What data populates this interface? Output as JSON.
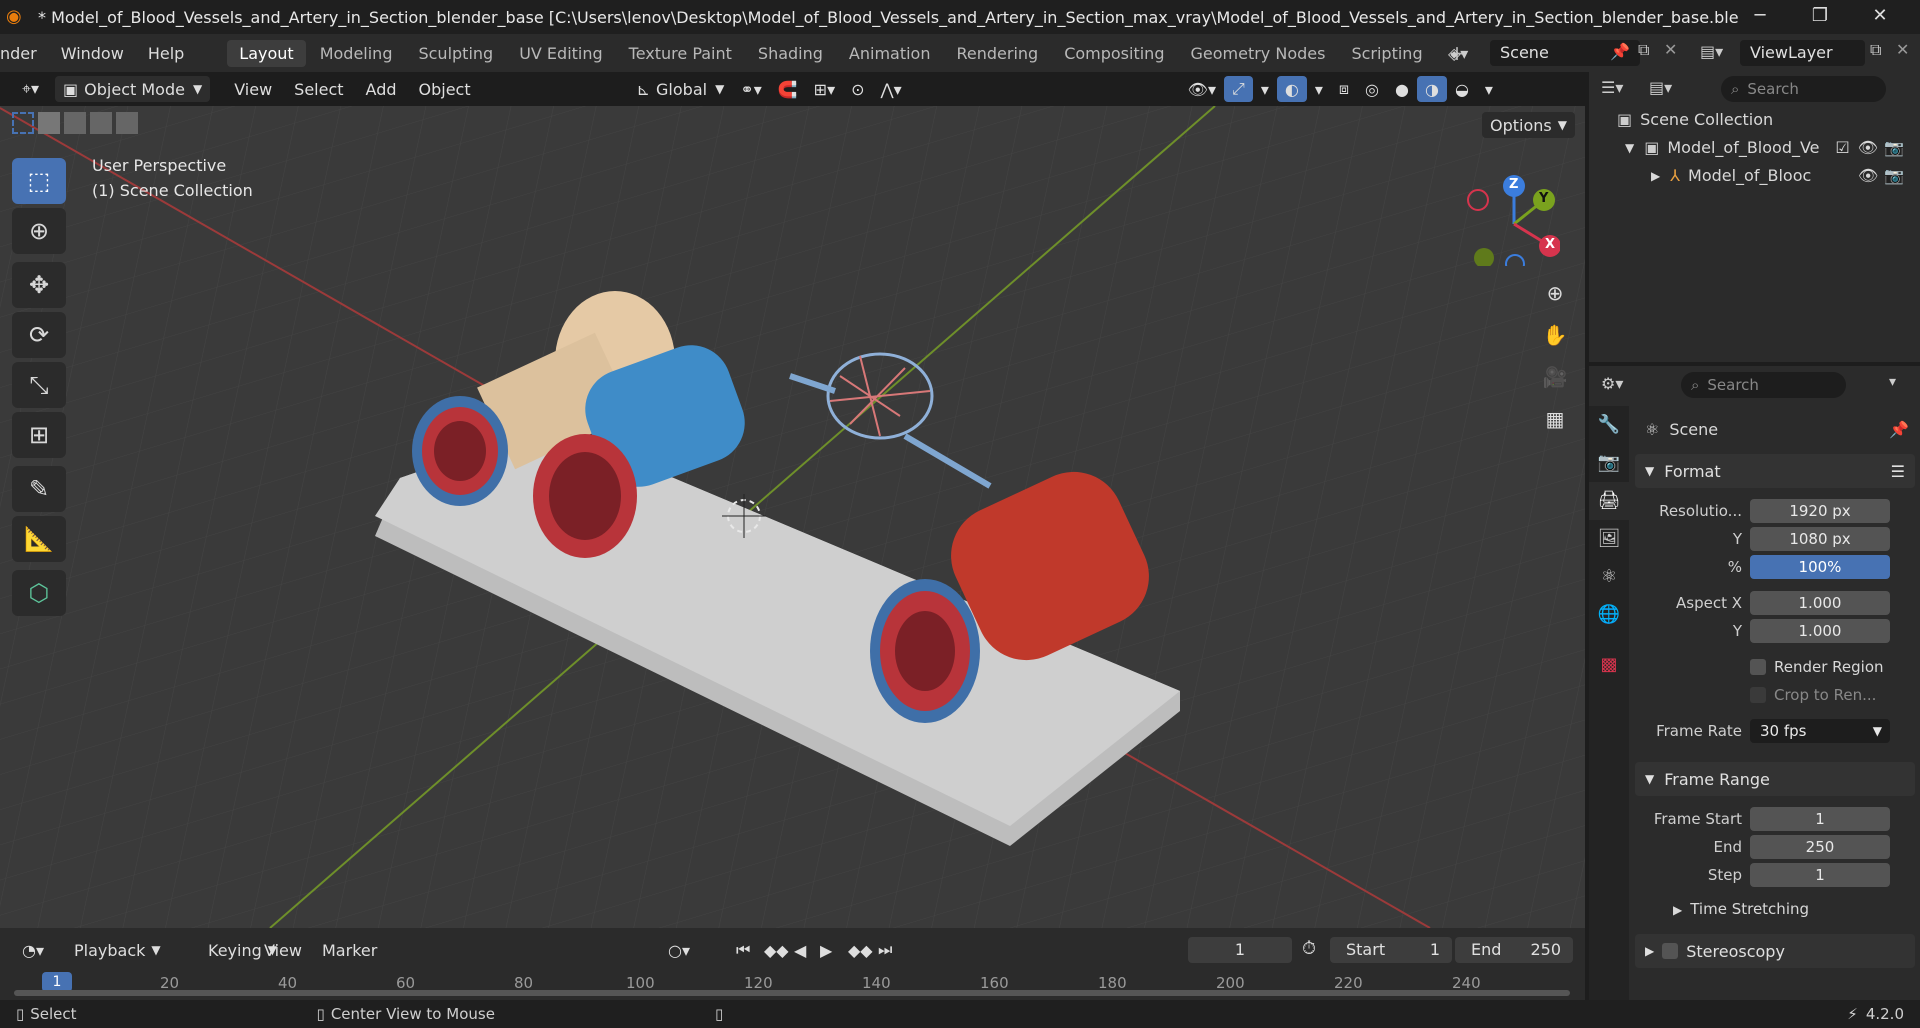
{
  "window": {
    "title": "* Model_of_Blood_Vessels_and_Artery_in_Section_blender_base [C:\\Users\\lenov\\Desktop\\Model_of_Blood_Vessels_and_Artery_in_Section_max_vray\\Model_of_Blood_Vessels_and_Artery_in_Section_blender_base.blend] - Blender...",
    "minimize": "─",
    "maximize": "❐",
    "close": "✕"
  },
  "menu": {
    "items": [
      "nder",
      "Window",
      "Help"
    ]
  },
  "workspaces": [
    "Layout",
    "Modeling",
    "Sculpting",
    "UV Editing",
    "Texture Paint",
    "Shading",
    "Animation",
    "Rendering",
    "Compositing",
    "Geometry Nodes",
    "Scripting"
  ],
  "add_workspace": "+",
  "scene": {
    "name": "Scene",
    "view_layer": "ViewLayer"
  },
  "viewport_header": {
    "mode": "Object Mode",
    "menus": [
      "View",
      "Select",
      "Add",
      "Object"
    ],
    "transform": "Global",
    "options": "Options"
  },
  "viewport": {
    "perspective": "User Perspective",
    "collection": "(1) Scene Collection",
    "gizmo": {
      "z": "Z",
      "y": "Y",
      "x": "X"
    }
  },
  "outliner": {
    "search_placeholder": "Search",
    "root": "Scene Collection",
    "items": [
      "Model_of_Blood_Ve",
      "Model_of_Blooc"
    ]
  },
  "properties": {
    "search_placeholder": "Search",
    "context": "Scene",
    "format": {
      "header": "Format",
      "resolution_x_label": "Resolutio...",
      "resolution_x": "1920 px",
      "y_label": "Y",
      "resolution_y": "1080 px",
      "pct_label": "%",
      "pct": "100%",
      "aspect_x_label": "Aspect X",
      "aspect_x": "1.000",
      "aspect_y_label": "Y",
      "aspect_y": "1.000",
      "render_region": "Render Region",
      "crop": "Crop to Ren...",
      "frame_rate_label": "Frame Rate",
      "frame_rate": "30 fps"
    },
    "frame_range": {
      "header": "Frame Range",
      "start_label": "Frame Start",
      "start": "1",
      "end_label": "End",
      "end": "250",
      "step_label": "Step",
      "step": "1"
    },
    "time_stretching": "Time Stretching",
    "stereoscopy": "Stereoscopy"
  },
  "timeline": {
    "menus": [
      "Playback",
      "Keying",
      "View",
      "Marker"
    ],
    "current_frame": "1",
    "start_label": "Start",
    "start": "1",
    "end_label": "End",
    "end": "250",
    "ticks": [
      "20",
      "40",
      "60",
      "80",
      "100",
      "120",
      "140",
      "160",
      "180",
      "200",
      "220",
      "240"
    ],
    "playhead": "1"
  },
  "status": {
    "select": "Select",
    "center": "Center View to Mouse",
    "version": "4.2.0"
  },
  "colors": {
    "accent": "#4772b3",
    "artery_red": "#b8343a",
    "vein_blue": "#3f8cc8"
  }
}
